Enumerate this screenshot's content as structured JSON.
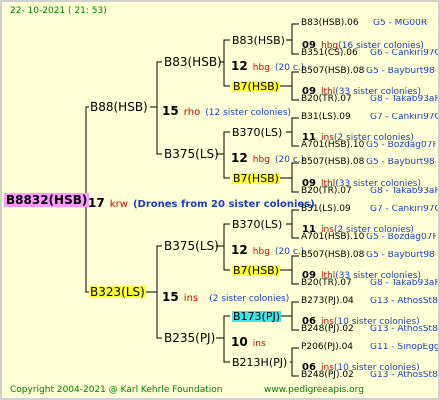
{
  "header": {
    "date": "22- 10-2021 ( 21: 53)"
  },
  "footer": {
    "copyright": "Copyright 2004-2021 @ Karl Kehrle Foundation",
    "url": "www.pedigreeapis.org"
  },
  "colors": {
    "background": "#ffffd6",
    "root_highlight": "#ff99ff",
    "yellow_highlight": "#ffff33",
    "cyan_highlight": "#3ee6e6",
    "label_blue": "#1a3dbf",
    "tag_red": "#cc0000"
  },
  "root": {
    "name": "B8832(HSB)",
    "gen": "17",
    "mark": "krw",
    "note": "(Drones from 20 sister colonies)"
  },
  "lvl1": [
    {
      "name": "B88(HSB)",
      "gen": "15",
      "mark": "rho",
      "note": "(12 sister colonies)"
    },
    {
      "name": "B323(LS)",
      "gen": "15",
      "mark": "ins",
      "note": "(2 sister colonies)"
    }
  ],
  "lvl2": [
    {
      "name": "B83(HSB)",
      "gen": "12",
      "mark": "hbg",
      "note": "(20 c.)"
    },
    {
      "name": "B375(LS)",
      "gen": "12",
      "mark": "hbg",
      "note": "(20 c.)"
    },
    {
      "name": "B375(LS)",
      "gen": "12",
      "mark": "hbg",
      "note": "(20 c.)"
    },
    {
      "name": "B235(PJ)",
      "gen": "10",
      "mark": "ins",
      "note": ""
    }
  ],
  "lvl3": [
    {
      "name": "B83(HSB)",
      "gen": "09",
      "mark": "hbg",
      "note": "(16 sister colonies)"
    },
    {
      "name": "B7(HSB)",
      "gen": "09",
      "mark": "lthl",
      "note": "(33 sister colonies)"
    },
    {
      "name": "B370(LS)",
      "gen": "11",
      "mark": "ins",
      "note": "(2 sister colonies)"
    },
    {
      "name": "B7(HSB)",
      "gen": "09",
      "mark": "lthl",
      "note": "(33 sister colonies)"
    },
    {
      "name": "B370(LS)",
      "gen": "11",
      "mark": "ins",
      "note": "(2 sister colonies)"
    },
    {
      "name": "B7(HSB)",
      "gen": "09",
      "mark": "lthl",
      "note": "(33 sister colonies)"
    },
    {
      "name": "B173(PJ)",
      "gen": "06",
      "mark": "ins",
      "note": "(10 sister colonies)"
    },
    {
      "name": "B213H(PJ)",
      "gen": "06",
      "mark": "ins",
      "note": "(10 sister colonies)"
    }
  ],
  "lvl4": [
    {
      "name": "B83(HSB).06",
      "origin": "G5 - MG00R"
    },
    {
      "name": "B351(CS).06",
      "origin": "G6 - Cankiri97Q"
    },
    {
      "name": "B507(HSB).08",
      "origin": "G5 - Bayburt98-3"
    },
    {
      "name": "B20(TR).07",
      "origin": "G8 - Takab93aR"
    },
    {
      "name": "B31(LS).09",
      "origin": "G7 - Cankiri97Q"
    },
    {
      "name": "A701(HSB).10",
      "origin": "G5 - Bozdag07R"
    },
    {
      "name": "B507(HSB).08",
      "origin": "G5 - Bayburt98-3"
    },
    {
      "name": "B20(TR).07",
      "origin": "G8 - Takab93aR"
    },
    {
      "name": "B31(LS).09",
      "origin": "G7 - Cankiri97Q"
    },
    {
      "name": "A701(HSB).10",
      "origin": "G5 - Bozdag07R"
    },
    {
      "name": "B507(HSB).08",
      "origin": "G5 - Bayburt98-3"
    },
    {
      "name": "B20(TR).07",
      "origin": "G8 - Takab93aR"
    },
    {
      "name": "B273(PJ).04",
      "origin": "G13 - AthosSt80R"
    },
    {
      "name": "B248(PJ).02",
      "origin": "G13 - AthosSt80R"
    },
    {
      "name": "P206(PJ).04",
      "origin": "G11 - SinopEgg86R"
    },
    {
      "name": "B248(PJ).02",
      "origin": "G13 - AthosSt80R"
    }
  ]
}
